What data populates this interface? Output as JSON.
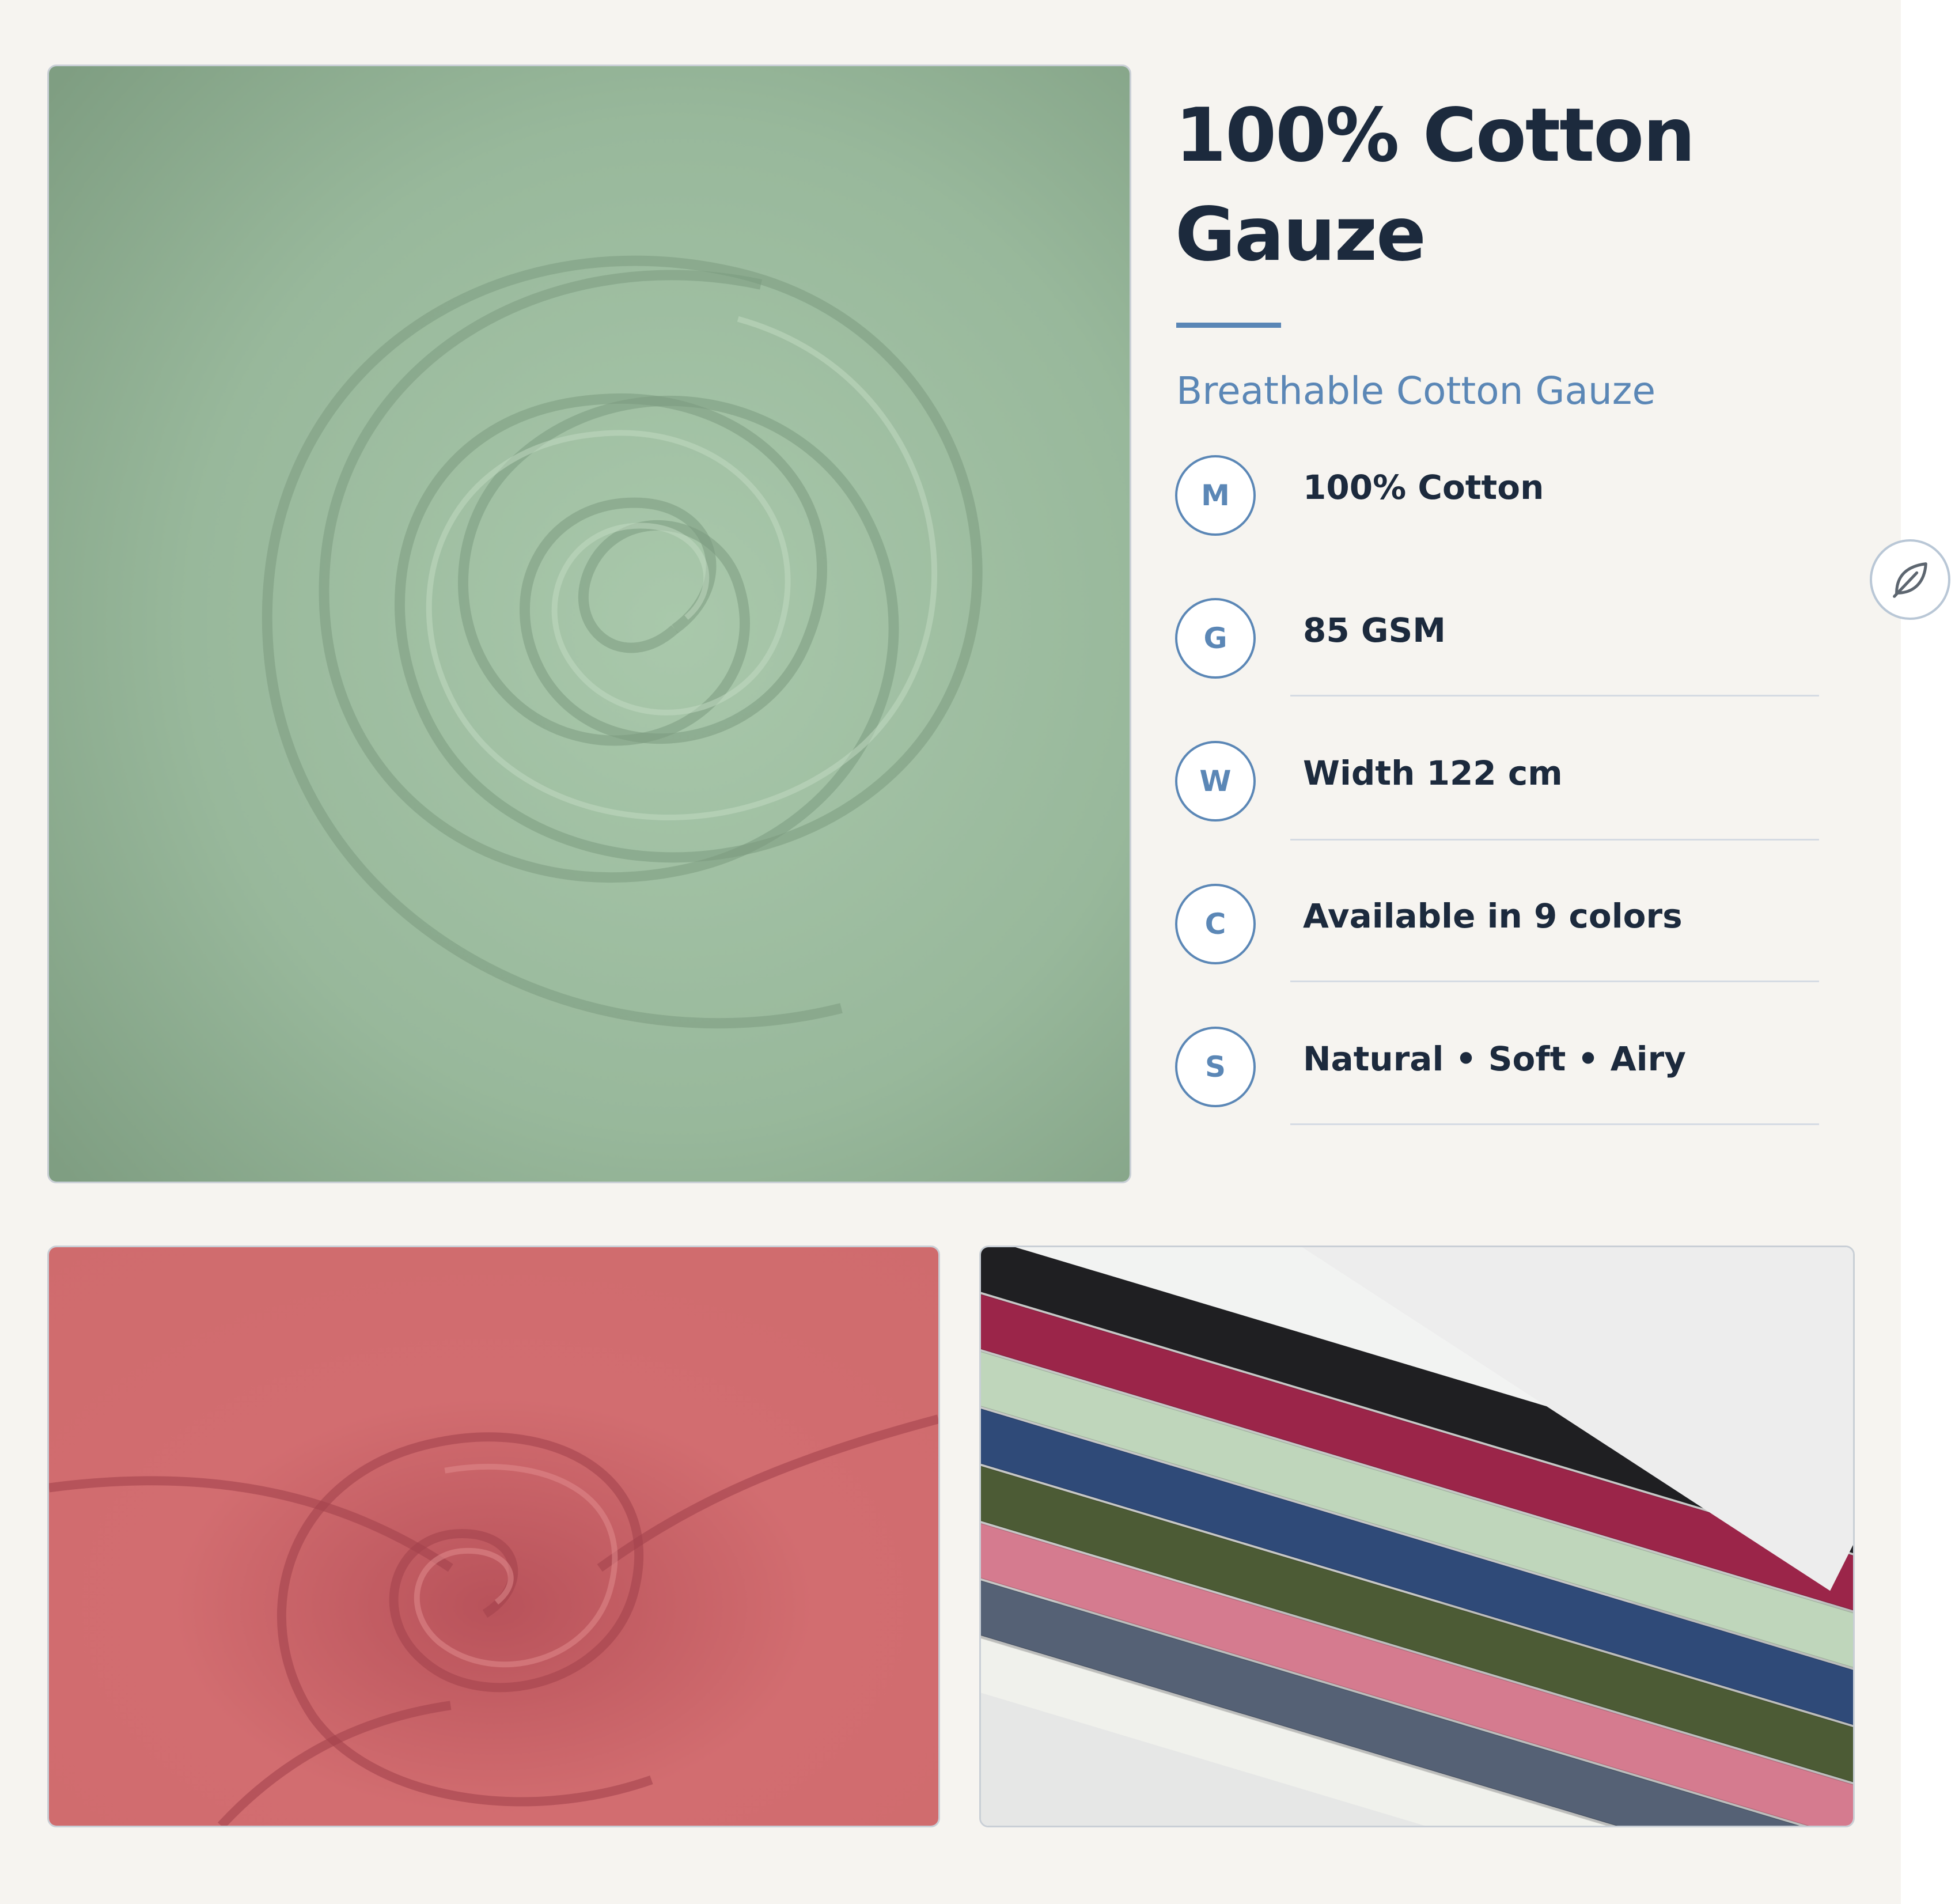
{
  "product": {
    "title_line1": "100% Cotton",
    "title_line2": "Gauze",
    "subtitle": "Breathable Cotton Gauze"
  },
  "specs": [
    {
      "badge": "M",
      "text": "100% Cotton"
    },
    {
      "badge": "G",
      "text": "85 GSM"
    },
    {
      "badge": "W",
      "text": "Width 122 cm"
    },
    {
      "badge": "C",
      "text": "Available in 9 colors"
    },
    {
      "badge": "S",
      "text": "Natural • Soft • Airy"
    }
  ],
  "images": {
    "main": {
      "color": "#9dbb9e"
    },
    "secondary": {
      "color": "#d06a6c"
    },
    "swatches": [
      "#2f4a78",
      "#bfd6bb",
      "#9b2549",
      "#1f1f22",
      "#4c5b35",
      "#d57b8f",
      "#556175",
      "#eef0ea",
      "#f4f4f2"
    ]
  },
  "icons": {
    "side_button": "leaf-icon"
  },
  "colors": {
    "accent": "#5b87b6",
    "heading": "#1c2a3d",
    "background": "#f6f4f0"
  }
}
